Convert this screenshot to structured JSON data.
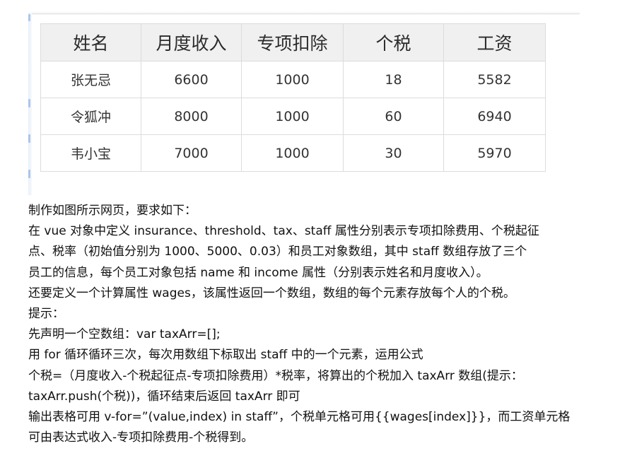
{
  "table": {
    "headers": [
      "姓名",
      "月度收入",
      "专项扣除",
      "个税",
      "工资"
    ],
    "rows": [
      [
        "张无忌",
        "6600",
        "1000",
        "18",
        "5582"
      ],
      [
        "令狐冲",
        "8000",
        "1000",
        "60",
        "6940"
      ],
      [
        "韦小宝",
        "7000",
        "1000",
        "30",
        "5970"
      ]
    ]
  },
  "description": {
    "lines": [
      "制作如图所示网页，要求如下：",
      "在 vue 对象中定义 insurance、threshold、tax、staff 属性分别表示专项扣除费用、个税起征",
      "点、税率（初始值分别为 1000、5000、0.03）和员工对象数组，其中 staff 数组存放了三个",
      "员工的信息，每个员工对象包括 name 和 income 属性（分别表示姓名和月度收入）。",
      "还要定义一个计算属性 wages，该属性返回一个数组，数组的每个元素存放每个人的个税。",
      "提示：",
      "先声明一个空数组：var taxArr=[];",
      "用 for 循环循环三次，每次用数组下标取出 staff 中的一个元素，运用公式",
      "个税=（月度收入-个税起征点-专项扣除费用）*税率，将算出的个税加入 taxArr 数组(提示：",
      "taxArr.push(个税))，循环结束后返回 taxArr 即可",
      "输出表格可用 v-for=”(value,index) in staff”，个税单元格可用{{wages[index]}}，而工资单元格",
      "可由表达式收入-专项扣除费用-个税得到。"
    ]
  }
}
